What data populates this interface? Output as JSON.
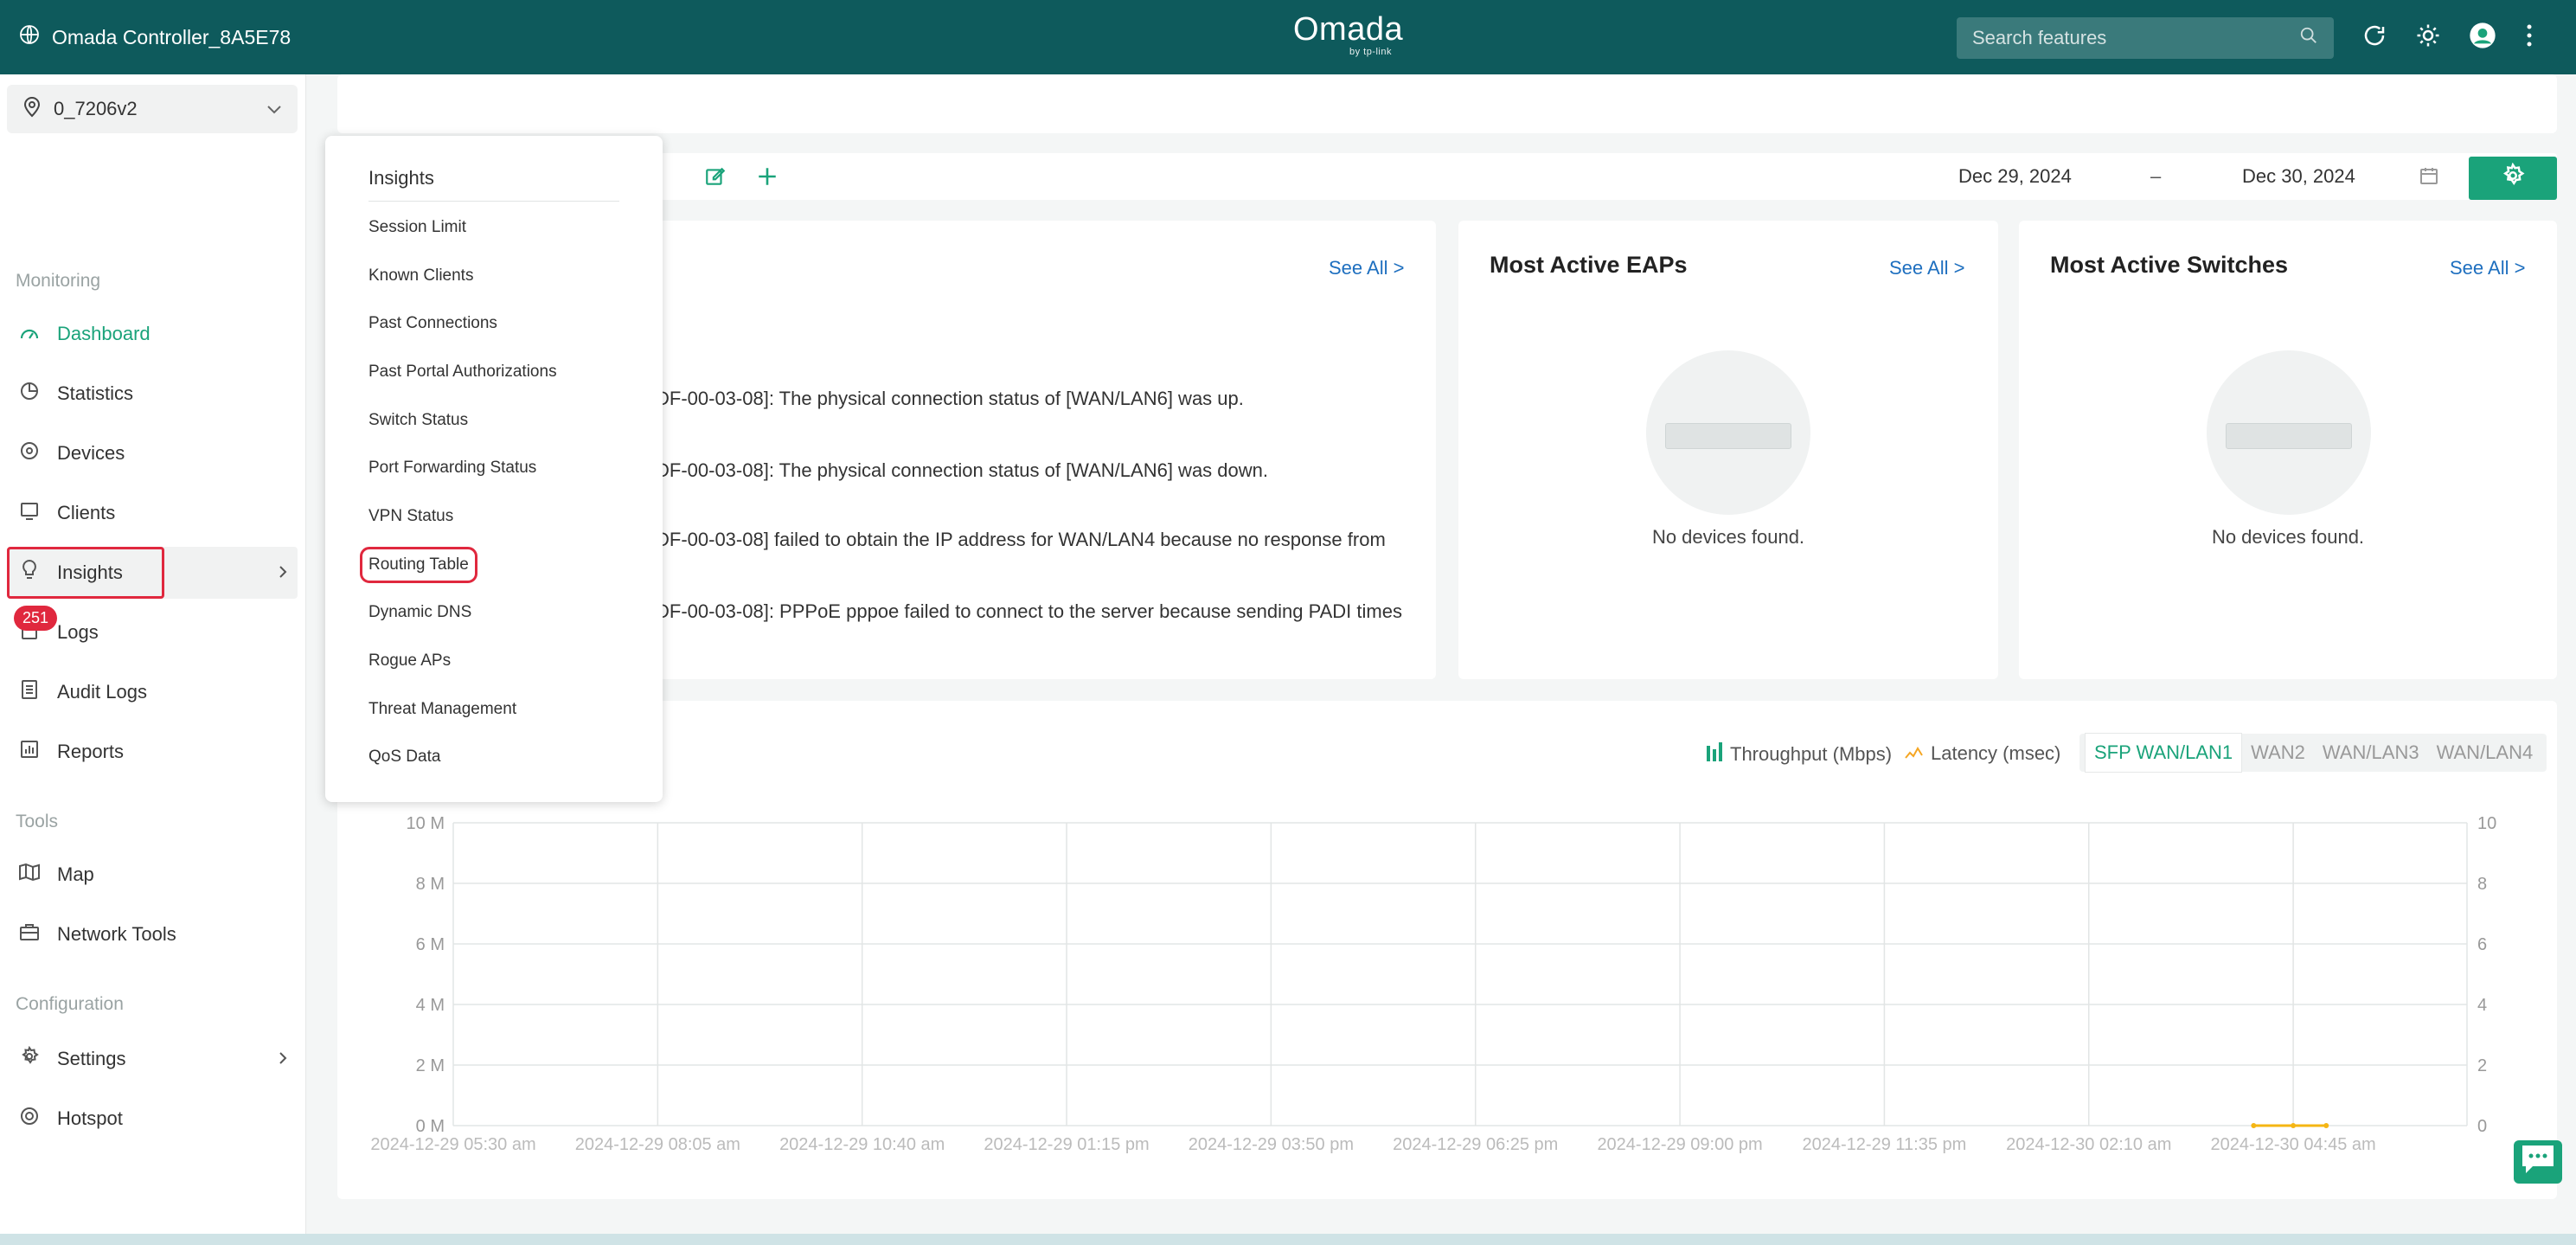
{
  "header": {
    "controller_name": "Omada Controller_8A5E78",
    "logo_text": "Omada",
    "logo_sub": "by tp-link",
    "search_placeholder": "Search features"
  },
  "sidebar": {
    "site": "0_7206v2",
    "monitoring_label": "Monitoring",
    "tools_label": "Tools",
    "configuration_label": "Configuration",
    "logs_badge": "251",
    "items": [
      {
        "label": "Dashboard",
        "icon": "dashboard-icon"
      },
      {
        "label": "Statistics",
        "icon": "pie-chart-icon"
      },
      {
        "label": "Devices",
        "icon": "device-icon"
      },
      {
        "label": "Clients",
        "icon": "clients-icon"
      },
      {
        "label": "Insights",
        "icon": "lightbulb-icon"
      },
      {
        "label": "Logs",
        "icon": "logs-icon"
      },
      {
        "label": "Audit Logs",
        "icon": "audit-logs-icon"
      },
      {
        "label": "Reports",
        "icon": "reports-icon"
      },
      {
        "label": "Map",
        "icon": "map-icon"
      },
      {
        "label": "Network Tools",
        "icon": "toolbox-icon"
      },
      {
        "label": "Settings",
        "icon": "gear-icon"
      },
      {
        "label": "Hotspot",
        "icon": "hotspot-icon"
      }
    ]
  },
  "insights_menu": {
    "title": "Insights",
    "items": [
      "Session Limit",
      "Known Clients",
      "Past Connections",
      "Past Portal Authorizations",
      "Switch Status",
      "Port Forwarding Status",
      "VPN Status",
      "Routing Table",
      "Dynamic DNS",
      "Rogue APs",
      "Threat Management",
      "QoS Data"
    ]
  },
  "toolbar": {
    "date_from": "Dec 29, 2024",
    "date_sep": "–",
    "date_to": "Dec 30, 2024"
  },
  "alerts_card": {
    "see_all": "See All >",
    "logs": [
      "DF-00-03-08]: The physical connection status of [WAN/LAN6] was up.",
      "DF-00-03-08]: The physical connection status of [WAN/LAN6] was down.",
      "DF-00-03-08] failed to obtain the IP address for WAN/LAN4 because no response from",
      "DF-00-03-08]: PPPoE pppoe failed to connect to the server because sending PADI times"
    ]
  },
  "eaps_card": {
    "title": "Most Active EAPs",
    "see_all": "See All >",
    "empty": "No devices found."
  },
  "switches_card": {
    "title": "Most Active Switches",
    "see_all": "See All >",
    "empty": "No devices found."
  },
  "chart_panel": {
    "legend_throughput": "Throughput (Mbps)",
    "legend_latency": "Latency (msec)",
    "tabs": [
      "SFP WAN/LAN1",
      "WAN2",
      "WAN/LAN3",
      "WAN/LAN4"
    ],
    "active_tab": "SFP WAN/LAN1"
  },
  "chart_data": {
    "type": "line",
    "xlabel": "",
    "ylabel": "",
    "left_axis_ticks": [
      "10 M",
      "8 M",
      "6 M",
      "4 M",
      "2 M",
      "0 M"
    ],
    "right_axis_ticks": [
      "10",
      "8",
      "6",
      "4",
      "2",
      "0"
    ],
    "x_tick_labels": [
      "2024-12-29 05:30 am",
      "2024-12-29 08:05 am",
      "2024-12-29 10:40 am",
      "2024-12-29 01:15 pm",
      "2024-12-29 03:50 pm",
      "2024-12-29 06:25 pm",
      "2024-12-29 09:00 pm",
      "2024-12-29 11:35 pm",
      "2024-12-30 02:10 am",
      "2024-12-30 04:45 am"
    ],
    "grid": true,
    "series": [
      {
        "name": "Latency (msec)",
        "axis": "right",
        "color": "#f5b614",
        "x": [
          "2024-12-30 04:15 am",
          "2024-12-30 04:45 am",
          "2024-12-30 05:10 am"
        ],
        "values": [
          0,
          0,
          0
        ]
      }
    ]
  }
}
